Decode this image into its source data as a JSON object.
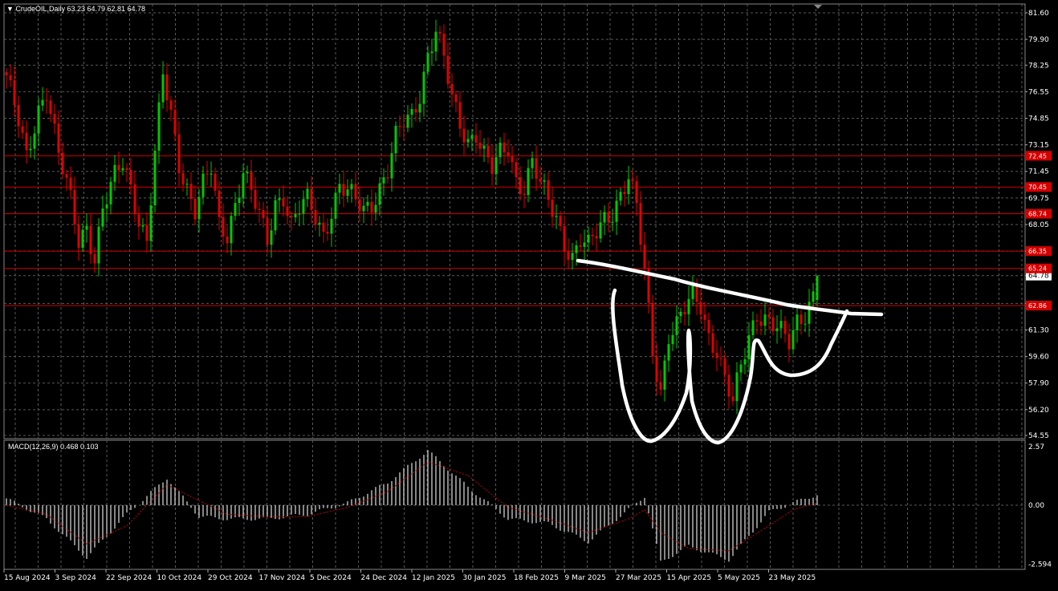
{
  "window": {
    "symbol_line": "CrudeOIL,Daily  63.23 64.79 62.81 64.78",
    "macd_line": "MACD(12,26,9) 0.468 0.103"
  },
  "colors": {
    "background": "#000000",
    "grid": "#5a5a5a",
    "bull": "#00c800",
    "bear": "#e00000",
    "level": "#d40000",
    "macd_hist": "#d0d0d0",
    "macd_signal": "#c00000",
    "drawing": "#ffffff"
  },
  "price_axis": {
    "ticks": [
      "81.60",
      "79.90",
      "78.25",
      "76.55",
      "74.85",
      "73.15",
      "71.45",
      "69.75",
      "68.05",
      "66.35",
      "64.78",
      "63.00",
      "61.30",
      "59.60",
      "57.90",
      "56.20",
      "54.55"
    ],
    "current": "64.78"
  },
  "level_tags": [
    {
      "price": 72.45,
      "label": "72.45"
    },
    {
      "price": 70.45,
      "label": "70.45"
    },
    {
      "price": 68.74,
      "label": "68.74"
    },
    {
      "price": 66.35,
      "label": "66.35"
    },
    {
      "price": 65.24,
      "label": "65.24"
    },
    {
      "price": 62.86,
      "label": "62.86"
    }
  ],
  "macd_axis": {
    "ticks": [
      "2.57",
      "0.00",
      "-2.594"
    ]
  },
  "time_axis": {
    "labels": [
      "15 Aug 2024",
      "3 Sep 2024",
      "22 Sep 2024",
      "10 Oct 2024",
      "29 Oct 2024",
      "17 Nov 2024",
      "5 Dec 2024",
      "24 Dec 2024",
      "12 Jan 2025",
      "30 Jan 2025",
      "18 Feb 2025",
      "9 Mar 2025",
      "27 Mar 2025",
      "15 Apr 2025",
      "5 May 2025",
      "23 May 2025"
    ]
  },
  "chart_data": {
    "type": "candlestick",
    "symbol": "CrudeOIL",
    "timeframe": "Daily",
    "last_bar": {
      "open": 63.23,
      "high": 64.79,
      "low": 62.81,
      "close": 64.78
    },
    "ylim": [
      54.55,
      81.6
    ],
    "horizontal_levels": [
      72.45,
      70.45,
      68.74,
      66.35,
      65.24,
      62.86
    ],
    "close_path": [
      [
        0,
        77.6
      ],
      [
        3,
        74.5
      ],
      [
        5,
        72.2
      ],
      [
        8,
        75.5
      ],
      [
        10,
        76.8
      ],
      [
        13,
        72.5
      ],
      [
        16,
        69.5
      ],
      [
        18,
        67.0
      ],
      [
        20,
        68.0
      ],
      [
        22,
        66.0
      ],
      [
        24,
        69.0
      ],
      [
        27,
        71.0
      ],
      [
        29,
        72.0
      ],
      [
        31,
        70.5
      ],
      [
        33,
        68.5
      ],
      [
        35,
        67.0
      ],
      [
        37,
        72.5
      ],
      [
        39,
        77.5
      ],
      [
        41,
        75.0
      ],
      [
        43,
        72.0
      ],
      [
        45,
        70.5
      ],
      [
        47,
        69.0
      ],
      [
        49,
        70.5
      ],
      [
        51,
        71.5
      ],
      [
        53,
        68.0
      ],
      [
        55,
        67.5
      ],
      [
        57,
        69.5
      ],
      [
        59,
        71.5
      ],
      [
        61,
        70.0
      ],
      [
        63,
        68.5
      ],
      [
        65,
        67.0
      ],
      [
        67,
        69.5
      ],
      [
        69,
        70.0
      ],
      [
        71,
        68.0
      ],
      [
        73,
        69.0
      ],
      [
        75,
        69.5
      ],
      [
        77,
        68.5
      ],
      [
        79,
        67.5
      ],
      [
        81,
        69.0
      ],
      [
        83,
        70.5
      ],
      [
        85,
        70.0
      ],
      [
        87,
        69.5
      ],
      [
        89,
        69.0
      ],
      [
        91,
        69.5
      ],
      [
        93,
        70.5
      ],
      [
        95,
        71.5
      ],
      [
        97,
        73.5
      ],
      [
        99,
        74.5
      ],
      [
        101,
        75.0
      ],
      [
        103,
        76.5
      ],
      [
        105,
        79.0
      ],
      [
        107,
        80.5
      ],
      [
        109,
        78.5
      ],
      [
        111,
        76.0
      ],
      [
        113,
        74.5
      ],
      [
        115,
        73.5
      ],
      [
        117,
        74.0
      ],
      [
        119,
        72.5
      ],
      [
        121,
        71.5
      ],
      [
        123,
        72.5
      ],
      [
        125,
        73.0
      ],
      [
        127,
        71.0
      ],
      [
        129,
        70.5
      ],
      [
        131,
        72.0
      ],
      [
        133,
        70.5
      ],
      [
        135,
        69.5
      ],
      [
        137,
        68.5
      ],
      [
        139,
        67.0
      ],
      [
        141,
        66.0
      ],
      [
        143,
        67.0
      ],
      [
        145,
        66.5
      ],
      [
        147,
        67.5
      ],
      [
        149,
        68.5
      ],
      [
        151,
        69.0
      ],
      [
        153,
        70.0
      ],
      [
        155,
        71.0
      ],
      [
        157,
        69.0
      ],
      [
        159,
        65.0
      ],
      [
        161,
        60.0
      ],
      [
        163,
        57.5
      ],
      [
        165,
        61.0
      ],
      [
        167,
        61.5
      ],
      [
        169,
        62.5
      ],
      [
        171,
        63.5
      ],
      [
        173,
        63.0
      ],
      [
        175,
        61.0
      ],
      [
        177,
        60.0
      ],
      [
        179,
        58.0
      ],
      [
        181,
        56.5
      ],
      [
        183,
        59.0
      ],
      [
        185,
        61.0
      ],
      [
        187,
        62.5
      ],
      [
        189,
        62.0
      ],
      [
        191,
        61.5
      ],
      [
        193,
        61.0
      ],
      [
        195,
        60.5
      ],
      [
        197,
        62.0
      ],
      [
        199,
        62.5
      ],
      [
        201,
        63.5
      ],
      [
        202,
        64.78
      ]
    ],
    "macd_hist_path": [
      [
        0,
        0.3
      ],
      [
        10,
        -0.6
      ],
      [
        20,
        -2.3
      ],
      [
        30,
        -0.4
      ],
      [
        40,
        1.2
      ],
      [
        48,
        -0.5
      ],
      [
        55,
        -0.6
      ],
      [
        65,
        -0.6
      ],
      [
        75,
        -0.4
      ],
      [
        85,
        0.1
      ],
      [
        95,
        1.0
      ],
      [
        105,
        2.4
      ],
      [
        115,
        0.8
      ],
      [
        125,
        -0.6
      ],
      [
        135,
        -0.8
      ],
      [
        145,
        -1.6
      ],
      [
        155,
        -0.2
      ],
      [
        159,
        0.4
      ],
      [
        163,
        -2.5
      ],
      [
        170,
        -1.8
      ],
      [
        180,
        -2.4
      ],
      [
        190,
        -0.3
      ],
      [
        196,
        0.1
      ],
      [
        202,
        0.468
      ]
    ],
    "macd_signal_path": [
      [
        0,
        0.0
      ],
      [
        10,
        -0.4
      ],
      [
        20,
        -1.7
      ],
      [
        30,
        -0.9
      ],
      [
        40,
        0.9
      ],
      [
        48,
        0.2
      ],
      [
        55,
        -0.4
      ],
      [
        65,
        -0.5
      ],
      [
        75,
        -0.5
      ],
      [
        85,
        -0.1
      ],
      [
        95,
        0.6
      ],
      [
        105,
        1.9
      ],
      [
        115,
        1.3
      ],
      [
        125,
        -0.1
      ],
      [
        135,
        -0.6
      ],
      [
        145,
        -1.2
      ],
      [
        155,
        -0.6
      ],
      [
        159,
        -0.2
      ],
      [
        163,
        -1.2
      ],
      [
        170,
        -1.9
      ],
      [
        180,
        -2.0
      ],
      [
        190,
        -0.9
      ],
      [
        196,
        -0.2
      ],
      [
        202,
        0.103
      ]
    ],
    "macd_ylim": [
      -2.594,
      2.57
    ]
  }
}
